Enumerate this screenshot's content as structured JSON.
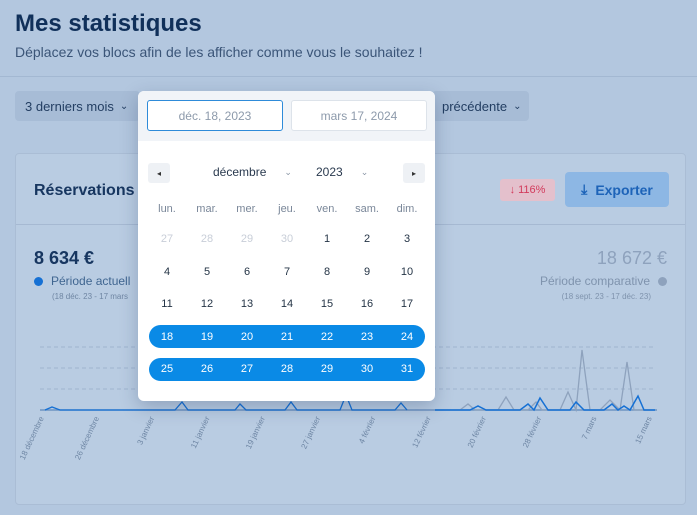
{
  "page": {
    "title": "Mes statistiques",
    "subtitle": "Déplacez vos blocs afin de les afficher comme vous le souhaitez !"
  },
  "filters": {
    "period_label": "3 derniers mois",
    "compare_label": "précédente"
  },
  "card": {
    "title": "Réservations b",
    "badge": "116%",
    "export_label": "Exporter",
    "current_amount": "8 634 €",
    "current_label": "Période actuell",
    "current_range": "(18 déc. 23 - 17 mars",
    "compare_amount": "18 672 €",
    "compare_label": "Période comparative",
    "compare_range": "(18 sept. 23 - 17 déc. 23)"
  },
  "chart_data": {
    "type": "line",
    "x_ticks": [
      "18 décembre",
      "26 décembre",
      "3 janvier",
      "11 janvier",
      "19 janvier",
      "27 janvier",
      "4 février",
      "12 février",
      "20 février",
      "28 février",
      "7 mars",
      "15 mars"
    ],
    "series": [],
    "grid": true
  },
  "datepicker": {
    "start_date": "déc. 18, 2023",
    "end_date": "mars 17, 2024",
    "month": "décembre",
    "year": "2023",
    "prev_icon": "◂",
    "next_icon": "▸",
    "weekdays": [
      "lun.",
      "mar.",
      "mer.",
      "jeu.",
      "ven.",
      "sam.",
      "dim."
    ],
    "weeks": [
      [
        "27",
        "28",
        "29",
        "30",
        "1",
        "2",
        "3"
      ],
      [
        "4",
        "5",
        "6",
        "7",
        "8",
        "9",
        "10"
      ],
      [
        "11",
        "12",
        "13",
        "14",
        "15",
        "16",
        "17"
      ],
      [
        "18",
        "19",
        "20",
        "21",
        "22",
        "23",
        "24"
      ],
      [
        "25",
        "26",
        "27",
        "28",
        "29",
        "30",
        "31"
      ]
    ],
    "muted_first_week_count": 4,
    "selected_weeks": [
      3,
      4
    ],
    "accent_color": "#0a8ae6"
  }
}
